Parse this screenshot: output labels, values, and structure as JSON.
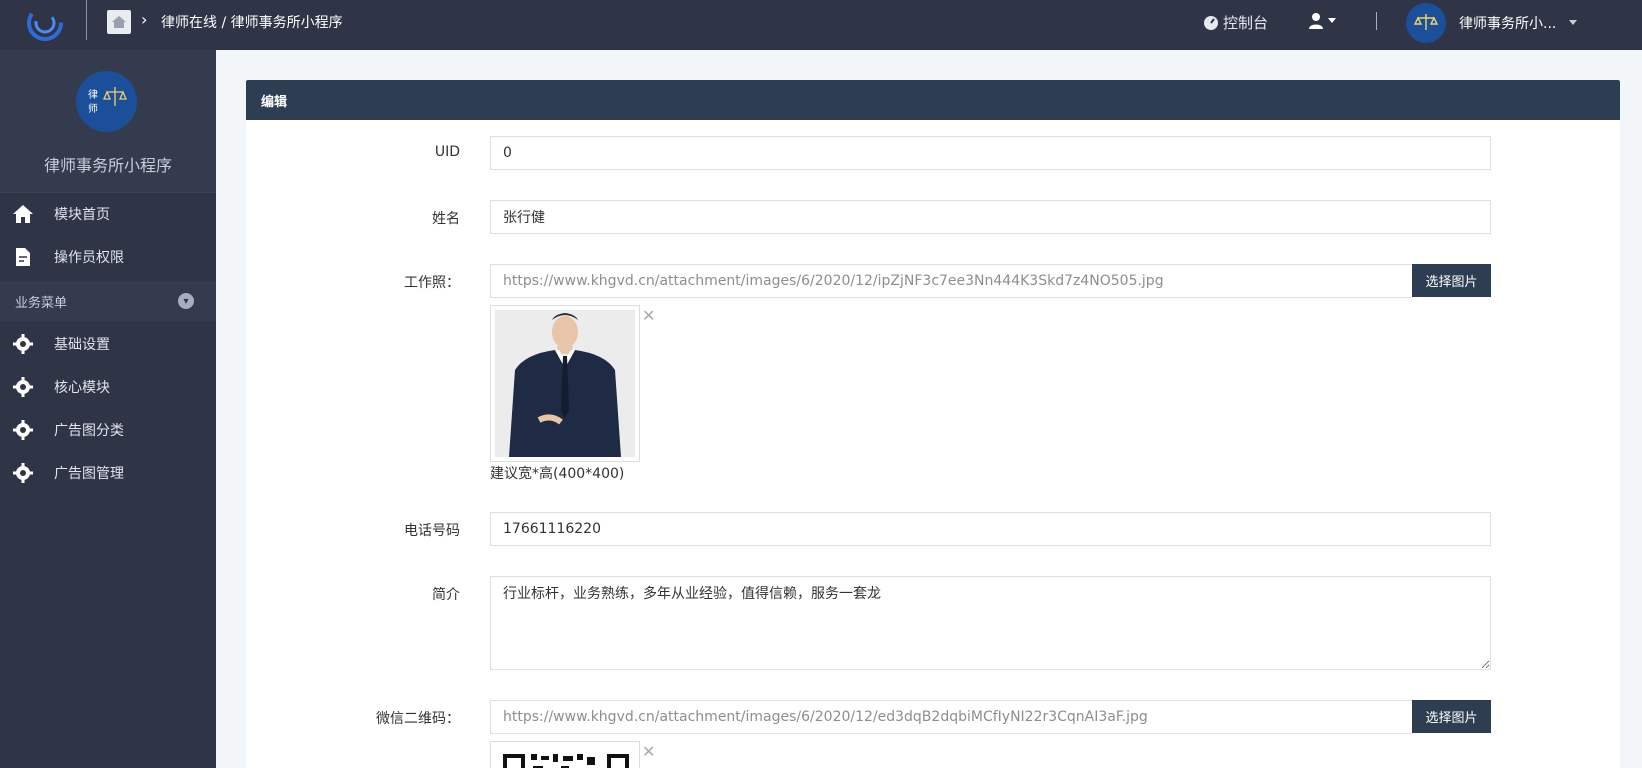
{
  "topbar": {
    "breadcrumb": "律师在线 / 律师事务所小程序",
    "dashboard_label": "控制台",
    "account_name": "律师事务所小...",
    "colors": {
      "bar": "#2f3447"
    }
  },
  "sidebar": {
    "app_name": "律师事务所小程序",
    "logo_text": "律师 事务所",
    "items": [
      {
        "label": "模块首页",
        "icon": "home-icon"
      },
      {
        "label": "操作员权限",
        "icon": "document-edit-icon"
      }
    ],
    "section_label": "业务菜单",
    "section_items": [
      {
        "label": "基础设置",
        "icon": "gear-icon"
      },
      {
        "label": "核心模块",
        "icon": "gear-icon"
      },
      {
        "label": "广告图分类",
        "icon": "gear-icon"
      },
      {
        "label": "广告图管理",
        "icon": "gear-icon"
      }
    ]
  },
  "panel": {
    "title": "编辑",
    "uid_label": "UID",
    "uid_value": "0",
    "name_label": "姓名",
    "name_value": "张行健",
    "photo_label": "工作照：",
    "photo_url": "https://www.khgvd.cn/attachment/images/6/2020/12/ipZjNF3c7ee3Nn444K3Skd7z4NO505.jpg",
    "pick_image_label": "选择图片",
    "photo_hint": "建议宽*高(400*400)",
    "phone_label": "电话号码",
    "phone_value": "17661116220",
    "intro_label": "简介",
    "intro_value": "行业标杆，业务熟练，多年从业经验，值得信赖，服务一套龙",
    "wechat_label": "微信二维码：",
    "wechat_url": "https://www.khgvd.cn/attachment/images/6/2020/12/ed3dqB2dqbiMCfIyNI22r3CqnAI3aF.jpg",
    "close_mark": "✕"
  }
}
